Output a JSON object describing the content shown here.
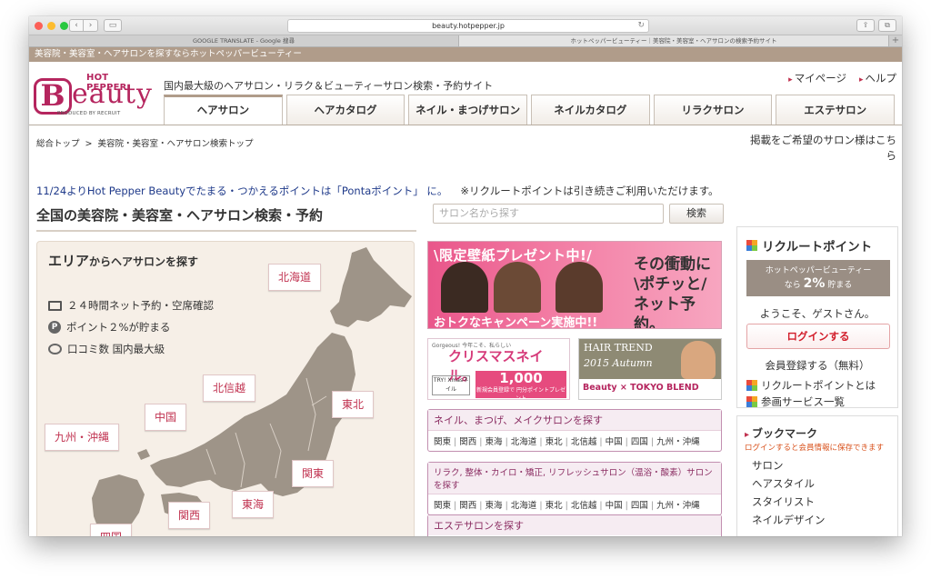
{
  "browser": {
    "url": "beauty.hotpepper.jp",
    "tabs": [
      "GOOGLE TRANSLATE - Google 搜尋",
      "ホットペッパービューティー｜美容院・美容室・ヘアサロンの検索予約サイト"
    ]
  },
  "top_strip": "美容院・美容室・ヘアサロンを探すならホットペッパービューティー",
  "logo": {
    "hot_pepper": "HOT PEPPER",
    "b": "B",
    "eauty": "eauty",
    "produced_by": "PRODUCED BY RECRUIT"
  },
  "header": {
    "tagline": "国内最大級のヘアサロン・リラク＆ビューティーサロン検索・予約サイト",
    "links": [
      "マイページ",
      "ヘルプ"
    ]
  },
  "gnav": [
    "ヘアサロン",
    "ヘアカタログ",
    "ネイル・まつげサロン",
    "ネイルカタログ",
    "リラクサロン",
    "エステサロン"
  ],
  "breadcrumb": {
    "home": "総合トップ",
    "sep": ">",
    "current": "美容院・美容室・ヘアサロン検索トップ"
  },
  "salon_link": "掲載をご希望のサロン様はこちら",
  "notice": {
    "main": "11/24よりHot Pepper Beautyでたまる・つかえるポイントは「Pontaポイント」 に。",
    "sub": "※リクルートポイントは引き続きご利用いただけます。"
  },
  "section_title": "全国の美容院・美容室・ヘアサロン検索・予約",
  "search": {
    "placeholder": "サロン名から探す",
    "button": "検索"
  },
  "map": {
    "title_a": "エリア",
    "title_b": "からヘアサロンを探す",
    "features": [
      "２４時間ネット予約・空席確認",
      "ポイント２%が貯まる",
      "口コミ数 国内最大級"
    ],
    "regions": [
      "北海道",
      "東北",
      "北信越",
      "関東",
      "東海",
      "関西",
      "中国",
      "九州・沖縄",
      "四国"
    ]
  },
  "banner_present": {
    "headline": "\\限定壁紙プレゼント中!/",
    "tagline": "おトクなキャンペーン実施中!!",
    "right": [
      "その衝動に",
      "\\ポチッと/",
      "ネット予約。"
    ]
  },
  "banner_xmas": {
    "top": "Gorgeous! 今年こそ、私らしい",
    "title": "クリスマスネイル。",
    "try": "TRY! Xmasネイル",
    "points": "1,000",
    "points_note": "新規会員登録で 円分ポイントプレゼント"
  },
  "banner_trend": {
    "title": "HAIR TREND",
    "season": "2015 Autumn",
    "bottom": "Beauty × TOKYO BLEND"
  },
  "link_boxes": [
    {
      "header": "ネイル、まつげ、メイクサロンを探す",
      "areas": [
        "関東",
        "関西",
        "東海",
        "北海道",
        "東北",
        "北信越",
        "中国",
        "四国",
        "九州・沖縄"
      ]
    },
    {
      "header": "リラク, 整体・カイロ・矯正, リフレッシュサロン（温浴・酸素）サロンを探す",
      "areas": [
        "関東",
        "関西",
        "東海",
        "北海道",
        "東北",
        "北信越",
        "中国",
        "四国",
        "九州・沖縄"
      ]
    },
    {
      "header": "エステサロンを探す",
      "areas": []
    }
  ],
  "recruit_point": {
    "title": "リクルートポイント",
    "band_line1": "ホットペッパービューティー",
    "band_pre": "なら",
    "band_pct": "2%",
    "band_post": "貯まる",
    "welcome": "ようこそ、ゲストさん。",
    "login": "ログインする",
    "register": "会員登録する（無料）",
    "links": [
      "リクルートポイントとは",
      "参画サービス一覧"
    ]
  },
  "bookmark": {
    "title": "ブックマーク",
    "note": "ログインすると会員情報に保存できます",
    "items": [
      "サロン",
      "ヘアスタイル",
      "スタイリスト",
      "ネイルデザイン"
    ]
  },
  "colors": {
    "brand": "#b5255e",
    "strip": "#b09c8a",
    "login_red": "#d21d2a",
    "notice_blue": "#1f3a8a"
  }
}
